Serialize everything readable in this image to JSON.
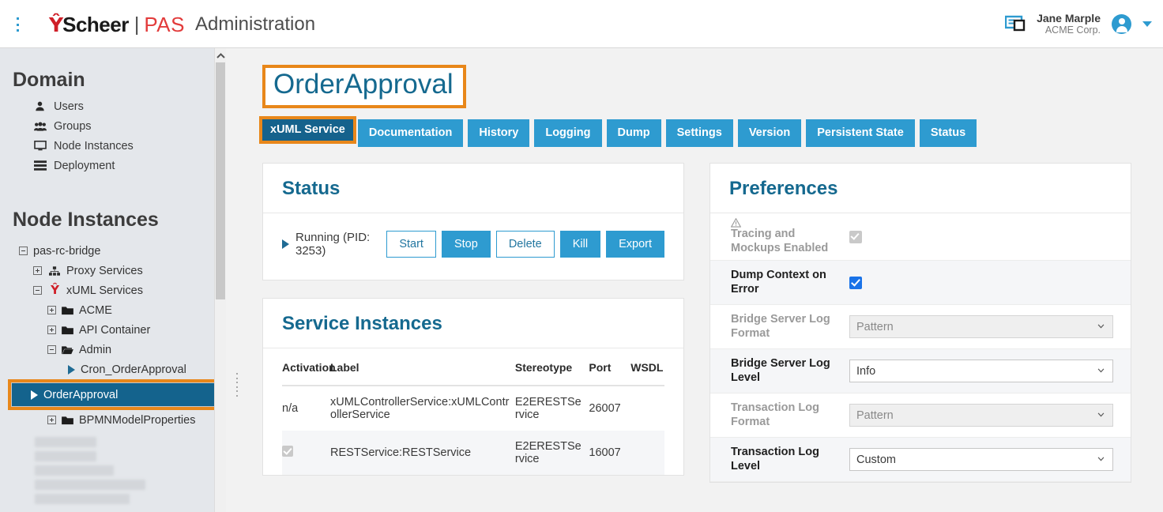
{
  "header": {
    "menu_icon": "kebab-menu-icon",
    "logo_mark": "Ŷ",
    "logo_scheer": "Scheer",
    "logo_divider": "|",
    "logo_pas": "PAS",
    "app_title": "Administration",
    "layout_icon": "layout-panel-icon",
    "user_name": "Jane Marple",
    "user_org": "ACME Corp.",
    "avatar_icon": "user-avatar-icon",
    "caret_icon": "chevron-down-icon",
    "accent_color": "#2e9bd0"
  },
  "sidebar": {
    "domain_heading": "Domain",
    "domain_items": [
      {
        "label": "Users",
        "icon": "user-icon"
      },
      {
        "label": "Groups",
        "icon": "users-group-icon"
      },
      {
        "label": "Node Instances",
        "icon": "monitor-icon"
      },
      {
        "label": "Deployment",
        "icon": "server-stack-icon"
      }
    ],
    "node_heading": "Node Instances",
    "tree": [
      {
        "label": "pas-rc-bridge",
        "depth": 0,
        "toggle": "minus",
        "icon": "none"
      },
      {
        "label": "Proxy Services",
        "depth": 1,
        "toggle": "plus",
        "icon": "sitemap-icon"
      },
      {
        "label": "xUML Services",
        "depth": 1,
        "toggle": "minus",
        "icon": "scheer-mark-icon"
      },
      {
        "label": "ACME",
        "depth": 2,
        "toggle": "plus",
        "icon": "folder-icon"
      },
      {
        "label": "API Container",
        "depth": 2,
        "toggle": "plus",
        "icon": "folder-icon"
      },
      {
        "label": "Admin",
        "depth": 2,
        "toggle": "minus",
        "icon": "folder-open-icon"
      },
      {
        "label": "Cron_OrderApproval",
        "depth": 3,
        "toggle": "none",
        "icon": "play-icon"
      },
      {
        "label": "BPMNModelProperties",
        "depth": 2,
        "toggle": "plus",
        "icon": "folder-icon"
      }
    ],
    "selected_node": {
      "label": "OrderApproval",
      "icon": "play-icon",
      "highlight_color": "#e8871a",
      "selected_bg": "#14638d"
    },
    "scrollbar": {
      "up_arrow_icon": "chevron-up-icon"
    },
    "splitter_icon": "drag-handle-icon"
  },
  "main": {
    "page_title": "OrderApproval",
    "title_highlight_color": "#e8871a",
    "tabs": [
      {
        "label": "xUML Service",
        "active": true
      },
      {
        "label": "Documentation",
        "active": false
      },
      {
        "label": "History",
        "active": false
      },
      {
        "label": "Logging",
        "active": false
      },
      {
        "label": "Dump",
        "active": false
      },
      {
        "label": "Settings",
        "active": false
      },
      {
        "label": "Version",
        "active": false
      },
      {
        "label": "Persistent State",
        "active": false
      },
      {
        "label": "Status",
        "active": false
      }
    ],
    "status_card": {
      "title": "Status",
      "state_icon": "play-icon",
      "state_text": "Running (PID: 3253)",
      "buttons": [
        {
          "label": "Start",
          "style": "ghost"
        },
        {
          "label": "Stop",
          "style": "solid"
        },
        {
          "label": "Delete",
          "style": "ghost"
        },
        {
          "label": "Kill",
          "style": "solid"
        },
        {
          "label": "Export",
          "style": "solid"
        }
      ]
    },
    "service_instances_card": {
      "title": "Service Instances",
      "columns": [
        "Activation",
        "Label",
        "Stereotype",
        "Port",
        "WSDL"
      ],
      "rows": [
        {
          "activation": "n/a",
          "activation_type": "text",
          "label": "xUMLControllerService:xUMLControllerService",
          "stereotype": "E2ERESTService",
          "port": "26007",
          "wsdl": ""
        },
        {
          "activation": "",
          "activation_type": "checkbox-disabled-checked",
          "label": "RESTService:RESTService",
          "stereotype": "E2ERESTService",
          "port": "16007",
          "wsdl": ""
        }
      ]
    },
    "preferences_card": {
      "title": "Preferences",
      "rows": [
        {
          "label": "Tracing and Mockups Enabled",
          "warn_icon": "warning-triangle-icon",
          "control": "checkbox",
          "checked": true,
          "disabled": true,
          "value": ""
        },
        {
          "label": "Dump Context on Error",
          "warn_icon": "",
          "control": "checkbox",
          "checked": true,
          "disabled": false,
          "value": ""
        },
        {
          "label": "Bridge Server Log Format",
          "warn_icon": "",
          "control": "select",
          "disabled": true,
          "value": "Pattern"
        },
        {
          "label": "Bridge Server Log Level",
          "warn_icon": "",
          "control": "select",
          "disabled": false,
          "value": "Info"
        },
        {
          "label": "Transaction Log Format",
          "warn_icon": "",
          "control": "select",
          "disabled": true,
          "value": "Pattern"
        },
        {
          "label": "Transaction Log Level",
          "warn_icon": "",
          "control": "select",
          "disabled": false,
          "value": "Custom"
        }
      ]
    }
  }
}
